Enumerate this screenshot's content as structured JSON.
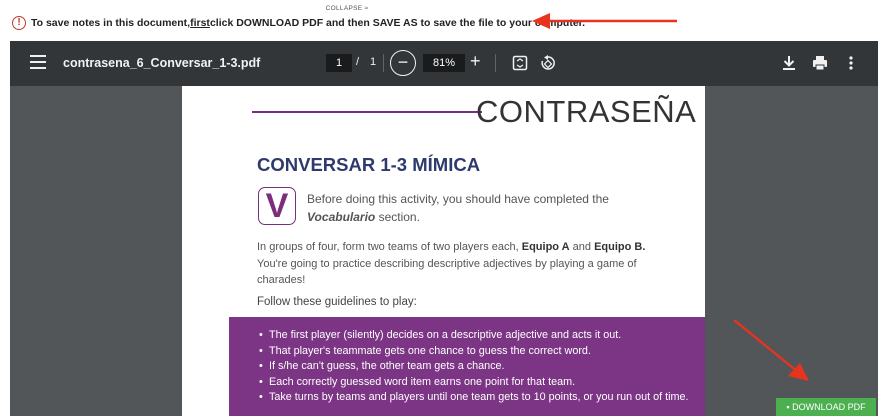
{
  "banner": {
    "collapse_label": "COLLAPSE ≈",
    "notice_prefix": "To save notes in this document, ",
    "notice_emphasis": "first",
    "notice_suffix": " click DOWNLOAD PDF and then SAVE AS to save the file to your computer."
  },
  "toolbar": {
    "file_name": "contrasena_6_Conversar_1-3.pdf",
    "page_current": "1",
    "page_separator": "/",
    "page_total": "1",
    "zoom": "81%"
  },
  "document": {
    "brand": "CONTRASEÑA",
    "title": "CONVERSAR 1-3 MÍMICA",
    "vocab_letter": "V",
    "intro_line1": "Before doing this activity, you should have completed the",
    "intro_line2": "Vocabulario",
    "intro_line2_suffix": " section.",
    "para_1": "In groups of four, form two teams of two players each, ",
    "team_a": "Equipo A",
    "para_and": " and ",
    "team_b": "Equipo B.",
    "para_2": "You're going to practice describing descriptive adjectives by playing a game of charades!",
    "follow": "Follow these guidelines to play:",
    "rules": [
      "The first player (silently) decides on a descriptive adjective and acts it out.",
      "That player's teammate gets one chance to guess the correct word.",
      "If s/he can't guess, the other team gets a chance.",
      "Each correctly guessed word item earns one point for that team.",
      "Take turns by teams and players until one team gets to 10 points, or you run out of time."
    ]
  },
  "download_button": "DOWNLOAD PDF",
  "colors": {
    "accent_purple": "#7b3584",
    "arrow_red": "#e8331e",
    "download_green": "#4caf50"
  }
}
